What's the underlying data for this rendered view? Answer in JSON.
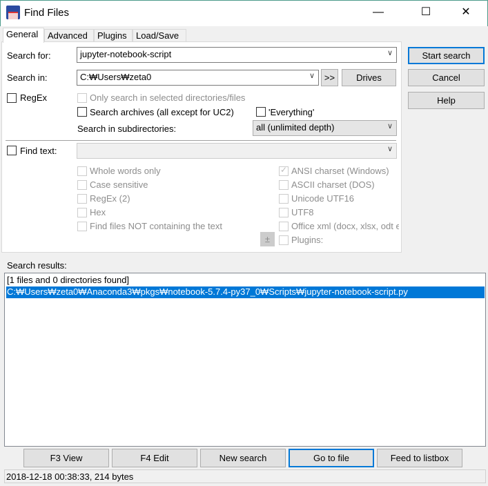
{
  "window": {
    "title": "Find Files",
    "minimize": "—",
    "maximize": "☐",
    "close": "✕"
  },
  "tabs": [
    "General",
    "Advanced",
    "Plugins",
    "Load/Save"
  ],
  "general": {
    "search_for_label": "Search for:",
    "search_for_value": "jupyter-notebook-script",
    "search_in_label": "Search in:",
    "search_in_value": "C:₩Users₩zeta0",
    "browse_label": ">>",
    "drives_label": "Drives",
    "regex_label": "RegEx",
    "only_selected_label": "Only search in selected directories/files",
    "search_archives_label": "Search archives (all except for UC2)",
    "everything_label": "'Everything'",
    "subdirs_label": "Search in subdirectories:",
    "subdirs_value": "all (unlimited depth)",
    "find_text_label": "Find text:",
    "left_options": [
      "Whole words only",
      "Case sensitive",
      "RegEx (2)",
      "Hex",
      "Find files NOT containing the text"
    ],
    "right_options": [
      "ANSI charset (Windows)",
      "ASCII charset (DOS)",
      "Unicode UTF16",
      "UTF8",
      "Office xml (docx, xlsx, odt etc)",
      "Plugins:"
    ],
    "plugins_toggle": "±"
  },
  "side_buttons": {
    "start": "Start search",
    "cancel": "Cancel",
    "help": "Help"
  },
  "results": {
    "label": "Search results:",
    "items": [
      "[1 files and 0 directories found]",
      "C:₩Users₩zeta0₩Anaconda3₩pkgs₩notebook-5.7.4-py37_0₩Scripts₩jupyter-notebook-script.py"
    ]
  },
  "bottom_buttons": [
    "F3 View",
    "F4 Edit",
    "New search",
    "Go to file",
    "Feed to listbox"
  ],
  "status": "2018-12-18 00:38:33, 214 bytes"
}
